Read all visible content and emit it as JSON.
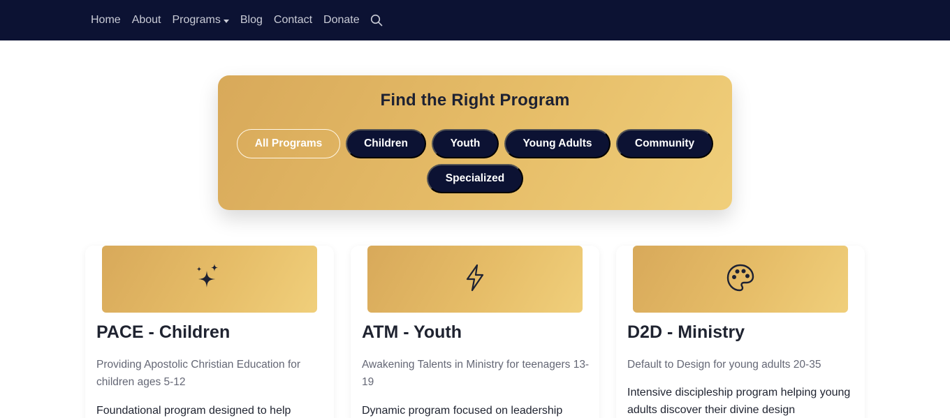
{
  "nav": {
    "links": [
      "Home",
      "About",
      "Programs",
      "Blog",
      "Contact",
      "Donate"
    ],
    "search_icon": "search-icon"
  },
  "filter": {
    "title": "Find the Right Program",
    "chips": [
      "All Programs",
      "Children",
      "Youth",
      "Young Adults",
      "Community",
      "Specialized"
    ],
    "active": "All Programs"
  },
  "cards": [
    {
      "icon": "sparkles-icon",
      "title": "PACE - Children",
      "subtitle": "Providing Apostolic Christian Education for children ages 5-12",
      "body": "Foundational program designed to help"
    },
    {
      "icon": "lightning-icon",
      "title": "ATM - Youth",
      "subtitle": "Awakening Talents in Ministry for teenagers 13-19",
      "body": "Dynamic program focused on leadership"
    },
    {
      "icon": "palette-icon",
      "title": "D2D - Ministry",
      "subtitle": "Default to Design for young adults 20-35",
      "body": "Intensive discipleship program helping young adults discover their divine design"
    }
  ],
  "colors": {
    "navbar": "#0c1233",
    "gold_start": "#d8a95a",
    "gold_end": "#f0cf7b",
    "chip": "#0c1233"
  }
}
